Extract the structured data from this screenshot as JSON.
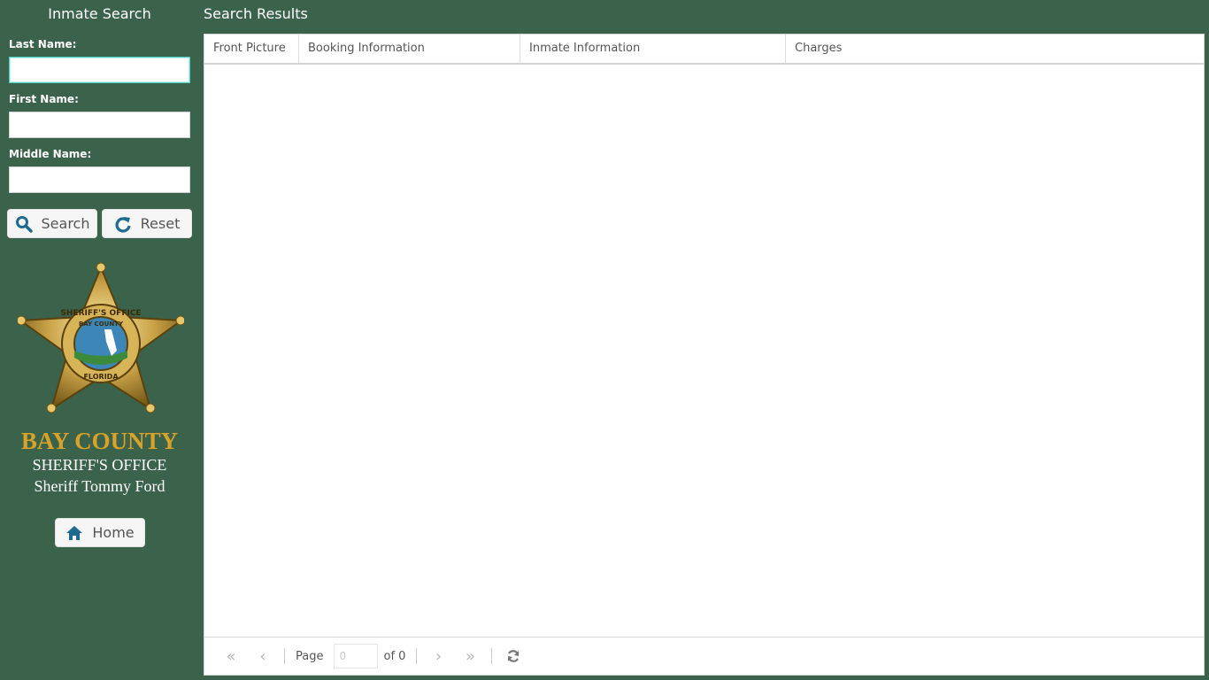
{
  "sidebar": {
    "title": "Inmate Search",
    "fields": [
      {
        "label": "Last Name:",
        "value": "",
        "placeholder": ""
      },
      {
        "label": "First Name:",
        "value": "",
        "placeholder": ""
      },
      {
        "label": "Middle Name:",
        "value": "",
        "placeholder": ""
      }
    ],
    "search_label": "Search",
    "reset_label": "Reset",
    "org": {
      "county": "BAY COUNTY",
      "office": "SHERIFF'S OFFICE",
      "sheriff": "Sheriff Tommy Ford"
    },
    "home_label": "Home",
    "badge_text": {
      "top": "SHERIFF'S OFFICE",
      "inner": "BAY COUNTY",
      "bottom": "FLORIDA"
    }
  },
  "results": {
    "title": "Search Results",
    "columns": [
      "Front Picture",
      "Booking Information",
      "Inmate Information",
      "Charges"
    ],
    "rows": [],
    "pager": {
      "page_label": "Page",
      "page_value": "0",
      "of_label": "of 0"
    }
  },
  "colors": {
    "background": "#3b634b",
    "accent_icon": "#1f6a8f",
    "county_gold": "#d9a228"
  }
}
